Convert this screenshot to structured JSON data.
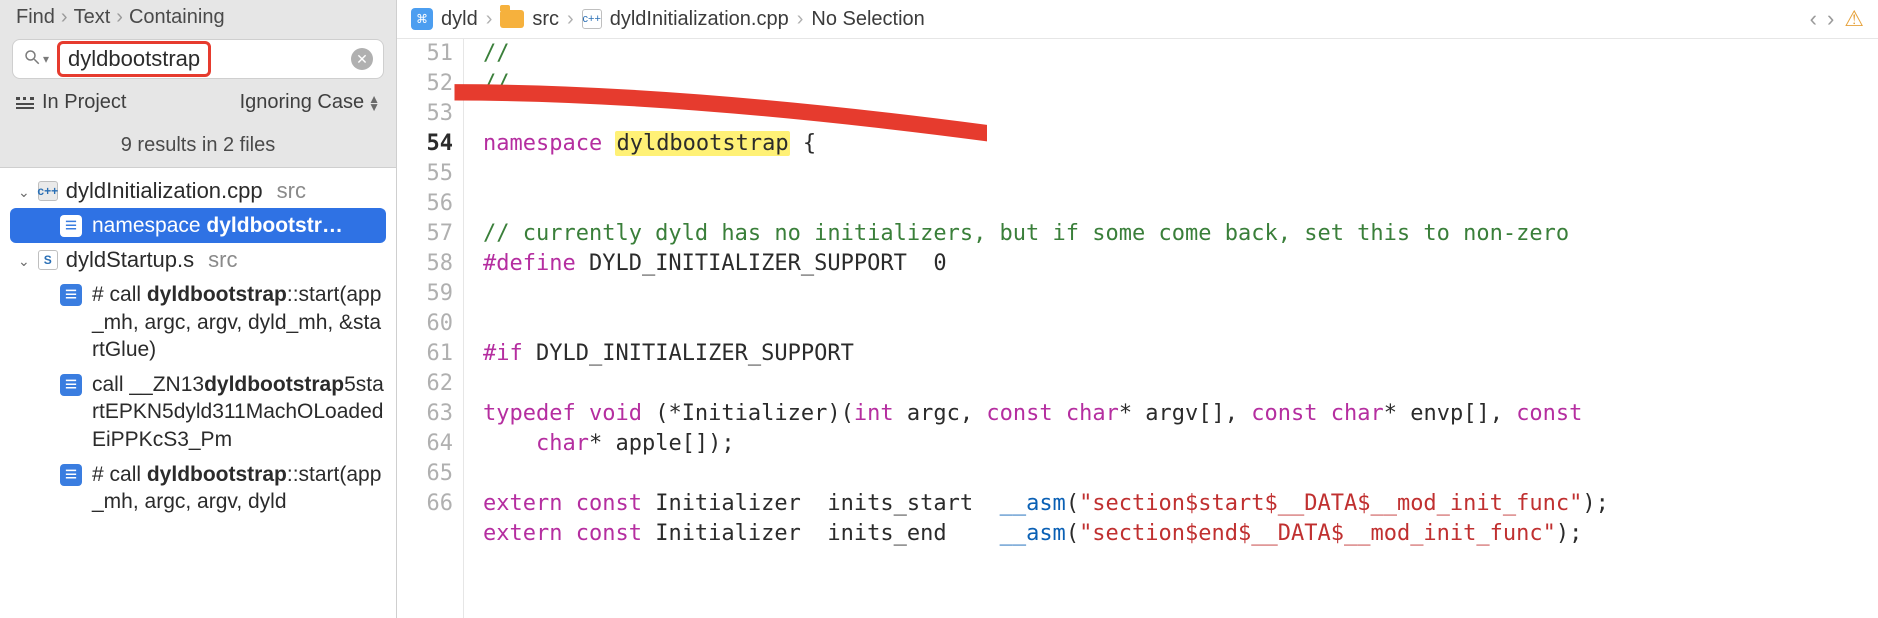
{
  "sidebar": {
    "breadcrumbs": [
      "Find",
      "Text",
      "Containing"
    ],
    "search": {
      "query": "dyldbootstrap",
      "placeholder": ""
    },
    "scope_label": "In Project",
    "ignore_case_label": "Ignoring Case",
    "results_summary": "9 results in 2 files",
    "files": [
      {
        "icon": "cpp",
        "name": "dyldInitialization.cpp",
        "dir": "src",
        "matches": [
          {
            "selected": true,
            "pre": "namespace ",
            "hit": "dyldbootstr…",
            "post": ""
          }
        ]
      },
      {
        "icon": "asm",
        "name": "dyldStartup.s",
        "dir": "src",
        "matches": [
          {
            "pre": "# call ",
            "hit": "dyldbootstrap",
            "post": "::start(app_mh, argc, argv, dyld_mh, &startGlue)"
          },
          {
            "pre": "call  __ZN13",
            "hit": "dyldbootstrap",
            "post": "5startEPKN5dyld311MachOLoadedEiPPKcS3_Pm"
          },
          {
            "pre": "# call ",
            "hit": "dyldbootstrap",
            "post": "::start(app_mh, argc, argv, dyld"
          }
        ]
      }
    ]
  },
  "editor": {
    "breadcrumbs": {
      "project": "dyld",
      "folder": "src",
      "file": "dyldInitialization.cpp",
      "selection": "No Selection"
    },
    "first_line": 51,
    "current_line": 54,
    "lines": [
      {
        "n": 51,
        "tokens": [
          {
            "cls": "hl-comment",
            "t": "//"
          }
        ]
      },
      {
        "n": 52,
        "tokens": [
          {
            "cls": "hl-comment",
            "t": "//"
          }
        ]
      },
      {
        "n": 53,
        "tokens": []
      },
      {
        "n": 54,
        "tokens": [
          {
            "cls": "hl-key",
            "t": "namespace "
          },
          {
            "cls": "hl-mark",
            "t": "dyldbootstrap"
          },
          {
            "cls": "hl-plain",
            "t": " {"
          }
        ]
      },
      {
        "n": 55,
        "tokens": []
      },
      {
        "n": 56,
        "tokens": []
      },
      {
        "n": 57,
        "tokens": [
          {
            "cls": "hl-comment",
            "t": "// currently dyld has no initializers, but if some come back, set this to non-zero"
          }
        ]
      },
      {
        "n": 58,
        "tokens": [
          {
            "cls": "hl-key",
            "t": "#define"
          },
          {
            "cls": "hl-plain",
            "t": " DYLD_INITIALIZER_SUPPORT  "
          },
          {
            "cls": "hl-plain",
            "t": "0"
          }
        ]
      },
      {
        "n": 59,
        "tokens": []
      },
      {
        "n": 60,
        "tokens": []
      },
      {
        "n": 61,
        "tokens": [
          {
            "cls": "hl-key",
            "t": "#if"
          },
          {
            "cls": "hl-plain",
            "t": " DYLD_INITIALIZER_SUPPORT"
          }
        ]
      },
      {
        "n": 62,
        "tokens": []
      },
      {
        "n": 63,
        "tokens": [
          {
            "cls": "hl-key",
            "t": "typedef "
          },
          {
            "cls": "hl-key",
            "t": "void"
          },
          {
            "cls": "hl-plain",
            "t": " (*Initializer)("
          },
          {
            "cls": "hl-key",
            "t": "int"
          },
          {
            "cls": "hl-plain",
            "t": " argc, "
          },
          {
            "cls": "hl-key",
            "t": "const "
          },
          {
            "cls": "hl-key",
            "t": "char"
          },
          {
            "cls": "hl-plain",
            "t": "* argv[], "
          },
          {
            "cls": "hl-key",
            "t": "const "
          },
          {
            "cls": "hl-key",
            "t": "char"
          },
          {
            "cls": "hl-plain",
            "t": "* envp[], "
          },
          {
            "cls": "hl-key",
            "t": "const"
          },
          {
            "cls": "hl-plain",
            "t": "\n    "
          },
          {
            "cls": "hl-key",
            "t": "char"
          },
          {
            "cls": "hl-plain",
            "t": "* apple[]);"
          }
        ]
      },
      {
        "n": 64,
        "tokens": []
      },
      {
        "n": 65,
        "tokens": [
          {
            "cls": "hl-key",
            "t": "extern "
          },
          {
            "cls": "hl-key",
            "t": "const"
          },
          {
            "cls": "hl-plain",
            "t": " Initializer  inits_start  "
          },
          {
            "cls": "hl-ident",
            "t": "__asm"
          },
          {
            "cls": "hl-plain",
            "t": "("
          },
          {
            "cls": "hl-str",
            "t": "\"section$start$__DATA$__mod_init_func\""
          },
          {
            "cls": "hl-plain",
            "t": ");"
          }
        ]
      },
      {
        "n": 66,
        "tokens": [
          {
            "cls": "hl-key",
            "t": "extern "
          },
          {
            "cls": "hl-key",
            "t": "const"
          },
          {
            "cls": "hl-plain",
            "t": " Initializer  inits_end    "
          },
          {
            "cls": "hl-ident",
            "t": "__asm"
          },
          {
            "cls": "hl-plain",
            "t": "("
          },
          {
            "cls": "hl-str",
            "t": "\"section$end$__DATA$__mod_init_func\""
          },
          {
            "cls": "hl-plain",
            "t": ");"
          }
        ]
      }
    ]
  }
}
